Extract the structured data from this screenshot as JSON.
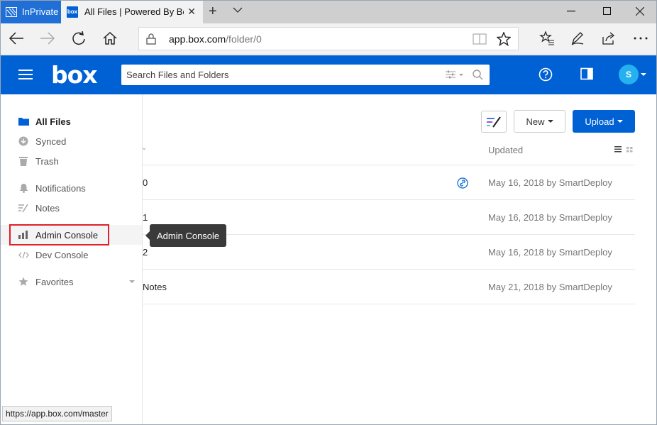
{
  "browser": {
    "inprivate_label": "InPrivate",
    "tab_title": "All Files | Powered By Box",
    "tab_favicon": "box",
    "address": {
      "host": "app.box.com",
      "path": "/folder/0"
    },
    "status_url": "https://app.box.com/master"
  },
  "header": {
    "logo": "box",
    "search_placeholder": "Search Files and Folders",
    "avatar_initial": "S",
    "brand_color": "#0061d5"
  },
  "sidebar": {
    "items": [
      {
        "label": "All Files",
        "icon": "folder-icon",
        "active": true
      },
      {
        "label": "Synced",
        "icon": "sync-icon"
      },
      {
        "label": "Trash",
        "icon": "trash-icon"
      },
      {
        "label": "Notifications",
        "icon": "bell-icon"
      },
      {
        "label": "Notes",
        "icon": "notes-icon"
      },
      {
        "label": "Admin Console",
        "icon": "bar-chart-icon",
        "highlighted": true
      },
      {
        "label": "Dev Console",
        "icon": "code-icon"
      },
      {
        "label": "Favorites",
        "icon": "star-icon"
      }
    ]
  },
  "tooltip": {
    "text": "Admin Console"
  },
  "toolbar": {
    "new_label": "New",
    "upload_label": "Upload"
  },
  "table": {
    "updated_header": "Updated",
    "rows": [
      {
        "name": "0",
        "updated": "May 16, 2018 by SmartDeploy",
        "shared_link": true
      },
      {
        "name": "1",
        "updated": "May 16, 2018 by SmartDeploy"
      },
      {
        "name": "2",
        "updated": "May 16, 2018 by SmartDeploy"
      },
      {
        "name": "Notes",
        "updated": "May 21, 2018 by SmartDeploy"
      }
    ]
  }
}
